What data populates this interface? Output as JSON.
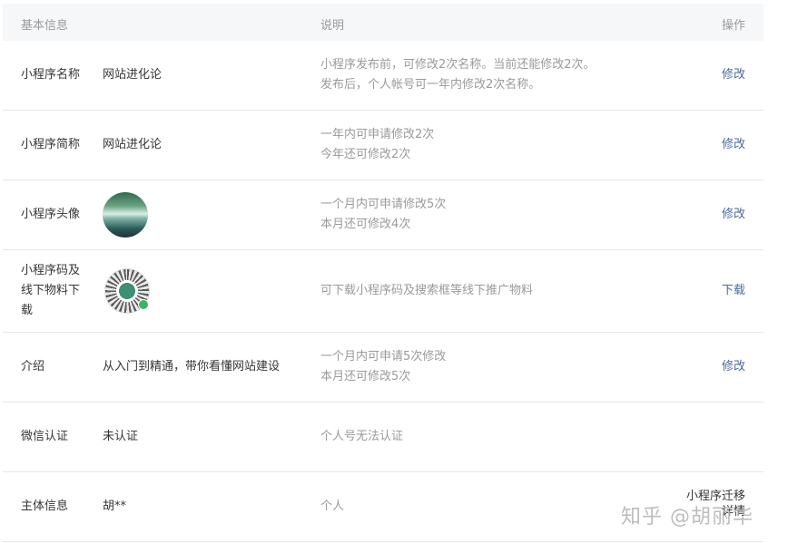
{
  "header": {
    "col_basic": "基本信息",
    "col_desc": "说明",
    "col_action": "操作"
  },
  "rows": [
    {
      "label": "小程序名称",
      "value": "网站进化论",
      "desc_line1": "小程序发布前，可修改2次名称。当前还能修改2次。",
      "desc_line2": "发布后，个人帐号可一年内修改2次名称。",
      "action": "修改"
    },
    {
      "label": "小程序简称",
      "value": "网站进化论",
      "desc_line1": "一年内可申请修改2次",
      "desc_line2": "今年还可修改2次",
      "action": "修改"
    },
    {
      "label": "小程序头像",
      "desc_line1": "一个月内可申请修改5次",
      "desc_line2": "本月还可修改4次",
      "action": "修改"
    },
    {
      "label_line1": "小程序码及",
      "label_line2": "线下物料下",
      "label_line3": "载",
      "desc_line1": "可下载小程序码及搜索框等线下推广物料",
      "action": "下载"
    },
    {
      "label": "介绍",
      "value": "从入门到精通，带你看懂网站建设",
      "desc_line1": "一个月内可申请5次修改",
      "desc_line2": "本月还可修改5次",
      "action": "修改"
    },
    {
      "label": "微信认证",
      "value": "未认证",
      "desc_line1": "个人号无法认证"
    },
    {
      "label": "主体信息",
      "value": "胡**",
      "desc_line1": "个人",
      "action_line1": "小程序迁移",
      "action_line2": "详情"
    }
  ],
  "watermark": "知乎 @胡丽华"
}
